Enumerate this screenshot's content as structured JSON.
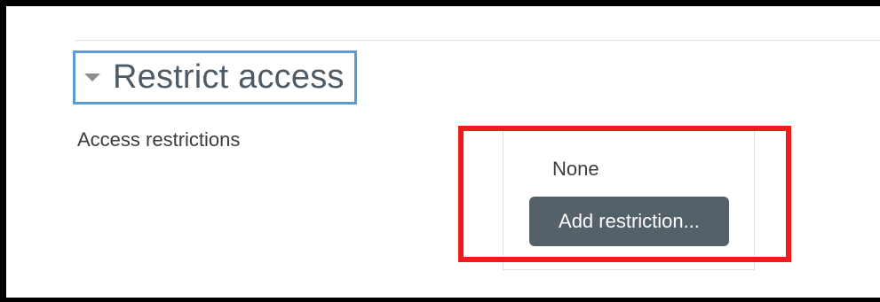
{
  "section": {
    "title": "Restrict access",
    "toggle_icon": "caret-down-icon"
  },
  "access": {
    "label": "Access restrictions",
    "current_value": "None",
    "add_button_label": "Add restriction..."
  },
  "colors": {
    "focus_outline": "#5b9bd5",
    "highlight_box": "#ee1c1c",
    "button_bg": "#556168",
    "heading_text": "#4d5b66"
  }
}
